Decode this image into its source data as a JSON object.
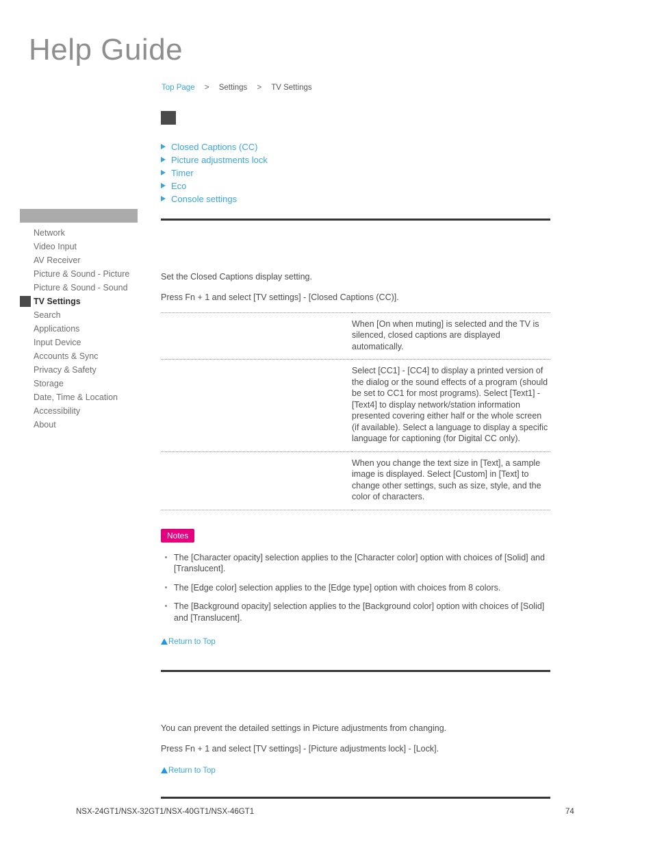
{
  "masthead": {
    "logo_text": "Help Guide"
  },
  "breadcrumb": {
    "items": [
      {
        "label": "Top Page",
        "link": true
      },
      {
        "label": "Settings",
        "link": false
      },
      {
        "label": "TV Settings",
        "link": false
      }
    ],
    "separator": ">"
  },
  "sidebar": {
    "items": [
      {
        "label": "Network",
        "active": false
      },
      {
        "label": "Video Input",
        "active": false
      },
      {
        "label": "AV Receiver",
        "active": false
      },
      {
        "label": "Picture & Sound - Picture",
        "active": false
      },
      {
        "label": "Picture & Sound - Sound",
        "active": false
      },
      {
        "label": "TV Settings",
        "active": true
      },
      {
        "label": "Search",
        "active": false
      },
      {
        "label": "Applications",
        "active": false
      },
      {
        "label": "Input Device",
        "active": false
      },
      {
        "label": "Accounts & Sync",
        "active": false
      },
      {
        "label": "Privacy & Safety",
        "active": false
      },
      {
        "label": "Storage",
        "active": false
      },
      {
        "label": "Date, Time & Location",
        "active": false
      },
      {
        "label": "Accessibility",
        "active": false
      },
      {
        "label": "About",
        "active": false
      }
    ]
  },
  "jump_links": [
    {
      "label": "Closed Captions (CC)"
    },
    {
      "label": "Picture adjustments lock"
    },
    {
      "label": "Timer"
    },
    {
      "label": "Eco"
    },
    {
      "label": "Console settings"
    }
  ],
  "section_cc": {
    "heading": "",
    "para1": "Set the Closed Captions display setting.",
    "para2": "Press Fn + 1 and select [TV settings] - [Closed Captions (CC)].",
    "table": {
      "rows": [
        {
          "label": "",
          "description": "When [On when muting] is selected and the TV is silenced, closed captions are displayed automatically."
        },
        {
          "label": "",
          "description": "Select [CC1] - [CC4] to display a printed version of the dialog or the sound effects of a program (should be set to CC1 for most programs). Select [Text1] - [Text4] to display network/station information presented covering either half or the whole screen (if available). Select a language to display a specific language for captioning (for Digital CC only)."
        },
        {
          "label": "",
          "description": "When you change the text size in [Text], a sample image is displayed. Select [Custom] in [Text] to change other settings, such as size, style, and the color of characters."
        }
      ]
    },
    "notes_badge": "Notes",
    "notes": [
      "The [Character opacity] selection applies to the [Character color] option with choices of [Solid] and [Translucent].",
      "The [Edge color] selection applies to the [Edge type] option with choices from 8 colors.",
      "The [Background opacity] selection applies to the [Background color] option with choices of [Solid] and [Translucent]."
    ],
    "return_to_top": "Return to Top"
  },
  "section_lock": {
    "heading": "",
    "para1": "You can prevent the detailed settings in Picture adjustments from changing.",
    "para2": "Press Fn + 1 and select [TV settings] - [Picture adjustments lock] - [Lock].",
    "return_to_top": "Return to Top"
  },
  "footer": {
    "models": "NSX-24GT1/NSX-32GT1/NSX-40GT1/NSX-46GT1",
    "page_number": "74"
  },
  "colors": {
    "link_blue": "#3aa5dc",
    "notes_magenta": "#e5007e",
    "rule_dark": "#343434",
    "sidebar_header_gray": "#ababab",
    "active_marker_gray": "#4a4a4a"
  }
}
